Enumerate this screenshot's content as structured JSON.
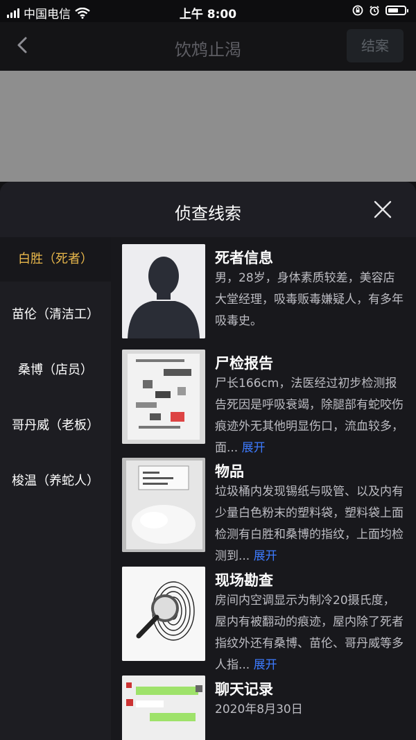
{
  "status_bar": {
    "carrier": "中国电信",
    "time": "上午 8:00"
  },
  "nav": {
    "title": "饮鸩止渴",
    "action_label": "结案"
  },
  "sheet": {
    "title": "侦查线索"
  },
  "sidebar": {
    "items": [
      {
        "label": "白胜（死者）",
        "active": true
      },
      {
        "label": "苗伦（清洁工）",
        "active": false
      },
      {
        "label": "桑博（店员）",
        "active": false
      },
      {
        "label": "哥丹威（老板）",
        "active": false
      },
      {
        "label": "梭温（养蛇人）",
        "active": false
      }
    ]
  },
  "clues": [
    {
      "title": "死者信息",
      "text": "男，28岁，身体素质较差，美容店大堂经理，吸毒贩毒嫌疑人，有多年吸毒史。",
      "expand": ""
    },
    {
      "title": "尸检报告",
      "text": "尸长166cm，法医经过初步检测报告死因是呼吸衰竭，除腿部有蛇咬伤痕迹外无其他明显伤口，流血较多，面...",
      "expand": "展开"
    },
    {
      "title": "物品",
      "text": "垃圾桶内发现锡纸与吸管、以及内有少量白色粉末的塑料袋，塑料袋上面检测有白胜和桑博的指纹，上面均检测到...",
      "expand": "展开"
    },
    {
      "title": "现场勘查",
      "text": "房间内空调显示为制冷20摄氏度，屋内有被翻动的痕迹，屋内除了死者指纹外还有桑博、苗伦、哥丹威等多人指...",
      "expand": "展开"
    },
    {
      "title": "聊天记录",
      "text": "2020年8月30日",
      "expand": ""
    }
  ]
}
